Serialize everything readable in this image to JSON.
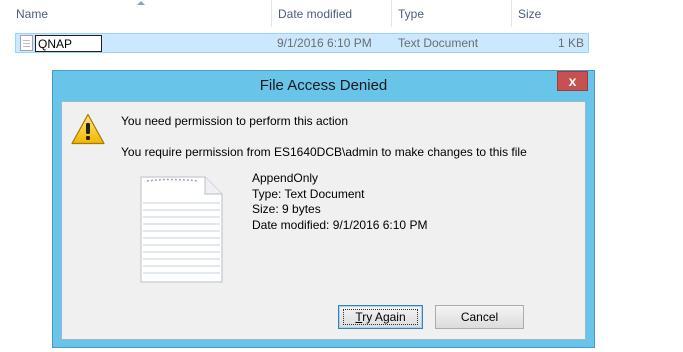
{
  "explorer": {
    "columns": {
      "name": "Name",
      "date_modified": "Date modified",
      "type": "Type",
      "size": "Size"
    },
    "selected_row": {
      "name_edit_value": "QNAP",
      "date_modified": "9/1/2016 6:10 PM",
      "type": "Text Document",
      "size": "1 KB"
    }
  },
  "dialog": {
    "title": "File Access Denied",
    "close_glyph": "x",
    "message_primary": "You need permission to perform this action",
    "message_secondary": "You require permission from ES1640DCB\\admin to make changes to this file",
    "file_info": {
      "name": "AppendOnly",
      "type": "Type: Text Document",
      "size": "Size: 9 bytes",
      "date_modified": "Date modified: 9/1/2016 6:10 PM"
    },
    "buttons": {
      "try_again_mnemonic": "T",
      "try_again_rest": "ry Again",
      "cancel": "Cancel"
    }
  },
  "icons": {
    "warning": "warning-icon",
    "file": "text-file-icon",
    "close": "close-icon"
  },
  "colors": {
    "dialog_frame": "#69c4ea",
    "selection": "#cce8ff",
    "close_button": "#c75050"
  }
}
